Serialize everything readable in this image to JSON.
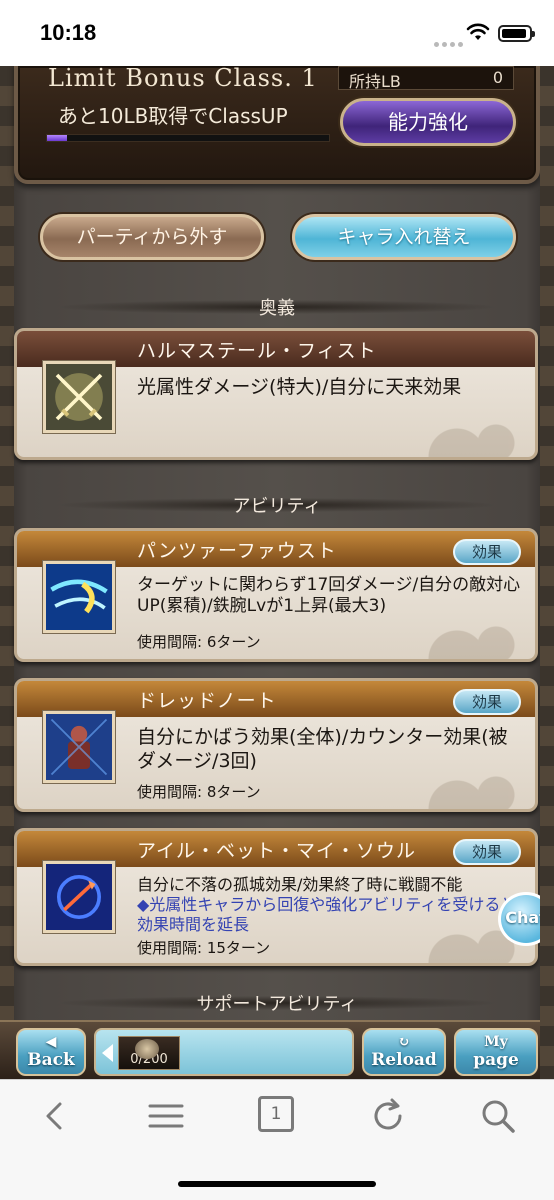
{
  "status": {
    "time": "10:18"
  },
  "limit_bonus": {
    "class_label": "Limit Bonus Class. 1",
    "owned_label": "所持LB",
    "owned_value": "0",
    "remaining_text": "あと10LB取得でClassUP",
    "progress_fraction": 0.07,
    "power_up_button": "能力強化"
  },
  "actions": {
    "remove_button": "パーティから外す",
    "swap_button": "キャラ入れ替え"
  },
  "sections": {
    "ougi": "奥義",
    "abilities": "アビリティ",
    "support": "サポートアビリティ"
  },
  "ougi": {
    "name": "ハルマステール・フィスト",
    "description": "光属性ダメージ(特大)/自分に天来効果"
  },
  "abilities": [
    {
      "name": "パンツァーファウスト",
      "effect_button": "効果",
      "description": "ターゲットに関わらず17回ダメージ/自分の敵対心UP(累積)/鉄腕Lvが1上昇(最大3)",
      "cooldown": "使用間隔: 6ターン"
    },
    {
      "name": "ドレッドノート",
      "effect_button": "効果",
      "description": "自分にかばう効果(全体)/カウンター効果(被ダメージ/3回)",
      "cooldown": "使用間隔: 8ターン"
    },
    {
      "name": "アイル・ベット・マイ・ソウル",
      "effect_button": "効果",
      "description": "自分に不落の孤城効果/効果終了時に戦闘不能",
      "description_extra": "◆光属性キャラから回復や強化アビリティを受けると効果時間を延長",
      "cooldown": "使用間隔: 15ターン"
    }
  ],
  "chat": {
    "label": "Chat"
  },
  "game_nav": {
    "back": "Back",
    "stamina": "0/200",
    "reload": "Reload",
    "mypage_line1": "My",
    "mypage_line2": "page"
  },
  "browser_toolbar": {
    "tab_count": "1",
    "icons": [
      "back-arrow-icon",
      "list-icon",
      "tabs-icon",
      "reload-icon",
      "search-icon"
    ]
  }
}
